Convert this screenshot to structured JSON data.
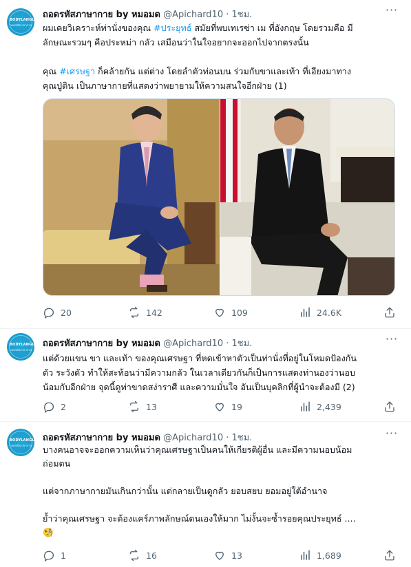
{
  "tweets": [
    {
      "avatar": {
        "line1": "BODYLANGUAGE CLA",
        "line2": "ถอดรหัสภาษากาย"
      },
      "name": "ถอดรหัสภาษากาย by หมอมด",
      "handle": "@Apichard10",
      "time": "· 1ชม.",
      "lines": [
        {
          "pre": "ผมเคยวิเคราะห์ท่านั่งของคุณ ",
          "tag": "#ประยุทธ์",
          "post": " สมัยที่พบเทเรซ่า เม ที่อังกฤษ โดยรวมคือ มี"
        },
        {
          "pre": "ลักษณะรวมๆ คือประหม่า กลัว เสมือนว่าในใจอยากจะออกไปจากตรงนั้น",
          "tag": "",
          "post": ""
        },
        {
          "pre": "",
          "tag": "",
          "post": ""
        },
        {
          "pre": "คุณ ",
          "tag": "#เศรษฐา",
          "post": " ก็คล้ายกัน แต่ต่าง โดยลำตัวท่อนบน ร่วมกับขาและเท้า ที่เอียงมาทาง"
        },
        {
          "pre": "คุณปู่ติน เป็นภาษากายที่แสดงว่าพยายามให้ความสนใจอีกฝ่าย (1)",
          "tag": "",
          "post": ""
        }
      ],
      "stats": {
        "replies": "20",
        "retweets": "142",
        "likes": "109",
        "views": "24.6K"
      }
    },
    {
      "avatar": {
        "line1": "BODYLANGUAGE CLA",
        "line2": "ถอดรหัสภาษากาย"
      },
      "name": "ถอดรหัสภาษากาย by หมอมด",
      "handle": "@Apichard10",
      "time": "· 1ชม.",
      "lines": [
        {
          "pre": "แต่ด้วยแขน ขา และเท้า ของคุณเศรษฐา ที่หดเข้าหาตัวเป็นท่านั่งที่อยู่ในโหมดป้องกัน",
          "tag": "",
          "post": ""
        },
        {
          "pre": "ตัว ระวังตัว ทำให้สะท้อนว่ามีความกลัว ในเวลาเดียวกันก็เป็นการแสดงท่านองว่านอบ",
          "tag": "",
          "post": ""
        },
        {
          "pre": "น้อมกับอีกฝ่าย จุดนี้ดูท่าขาดสง่าราศี และความมั่นใจ อันเป็นบุคลิกที่ผู้นำจะต้องมี (2)",
          "tag": "",
          "post": ""
        }
      ],
      "stats": {
        "replies": "2",
        "retweets": "13",
        "likes": "19",
        "views": "2,439"
      }
    },
    {
      "avatar": {
        "line1": "BODYLANGUAGE CLA",
        "line2": "ถอดรหัสภาษากาย"
      },
      "name": "ถอดรหัสภาษากาย by หมอมด",
      "handle": "@Apichard10",
      "time": "· 1ชม.",
      "lines": [
        {
          "pre": "บางคนอาจจะออกความเห็นว่าคุณเศรษฐาเป็นคนให้เกียรติผู้อื่น และมีความนอบน้อม",
          "tag": "",
          "post": ""
        },
        {
          "pre": "ถ่อมตน",
          "tag": "",
          "post": ""
        },
        {
          "pre": "",
          "tag": "",
          "post": ""
        },
        {
          "pre": "แต่จากภาษากายมันเกินกว่านั้น แต่กลายเป็นดูกลัว ยอบสยบ ยอมอยู่ใต้อำนาจ",
          "tag": "",
          "post": ""
        },
        {
          "pre": "",
          "tag": "",
          "post": ""
        },
        {
          "pre": "ย้ำว่าคุณเศรษฐา จะต้องแคร์ภาพลักษณ์ตนเองให้มาก ไม่งั้นจะซ้ำรอยคุณประยุทธ์ ....",
          "tag": "",
          "post": ""
        },
        {
          "pre": "🧐",
          "tag": "",
          "post": ""
        }
      ],
      "stats": {
        "replies": "1",
        "retweets": "16",
        "likes": "13",
        "views": "1,689"
      }
    }
  ],
  "colors": {
    "text": "#0f1419",
    "muted": "#536471",
    "accent": "#1d9bf0",
    "divider": "#eff3f4"
  },
  "icons": [
    "reply-icon",
    "retweet-icon",
    "like-icon",
    "views-icon",
    "share-icon",
    "more-icon"
  ]
}
